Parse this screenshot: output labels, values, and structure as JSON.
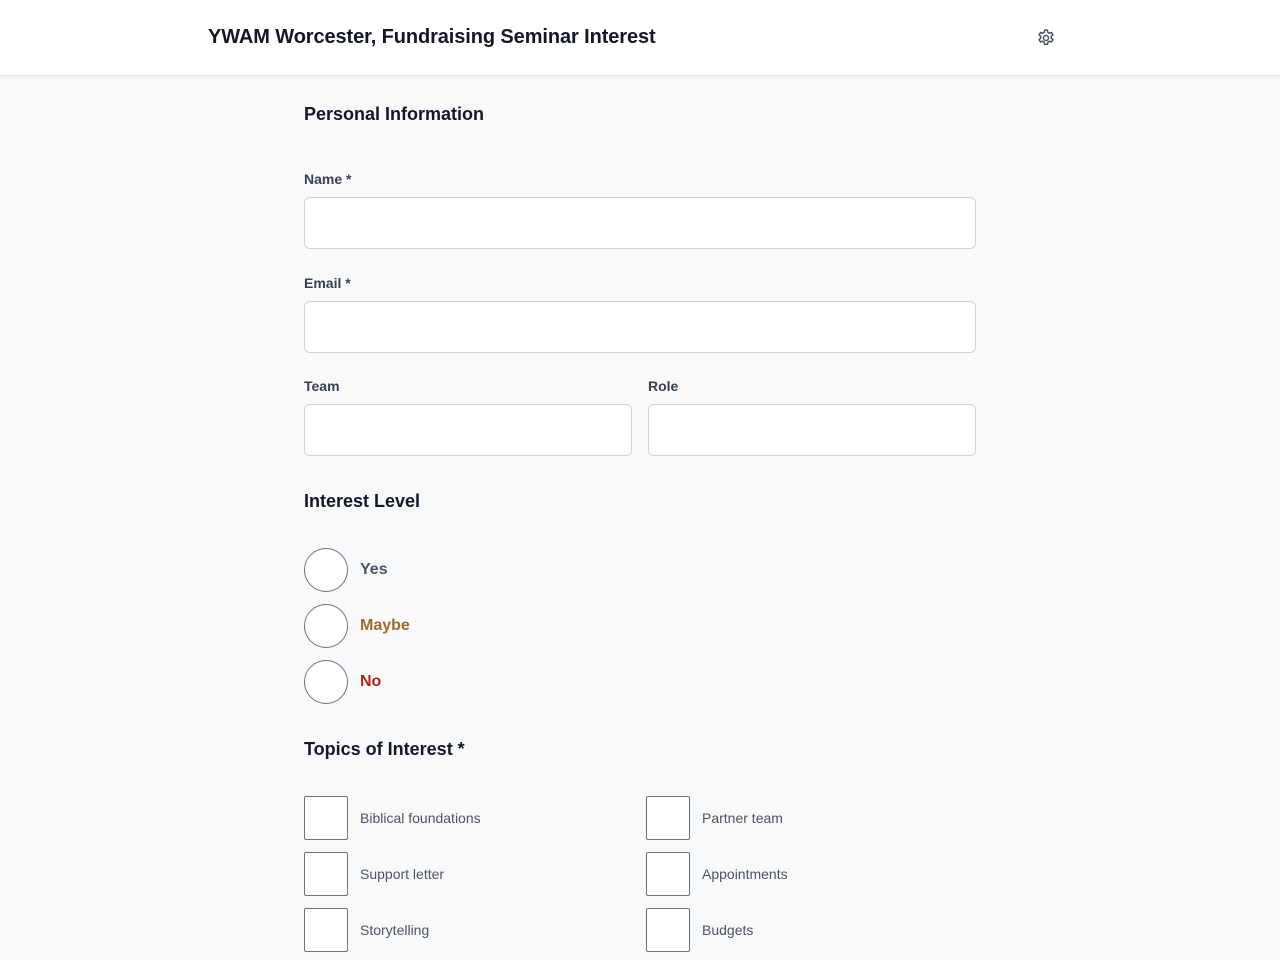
{
  "header": {
    "title": "YWAM Worcester, Fundraising Seminar Interest",
    "settings_icon": "gear-icon"
  },
  "personal": {
    "section_title": "Personal Information",
    "name_label": "Name *",
    "name_value": "",
    "email_label": "Email *",
    "email_value": "",
    "team_label": "Team",
    "team_value": "",
    "role_label": "Role",
    "role_value": ""
  },
  "interest": {
    "section_title": "Interest Level",
    "options": [
      {
        "label": "Yes",
        "color": "#4b5563"
      },
      {
        "label": "Maybe",
        "color": "#a16b2a"
      },
      {
        "label": "No",
        "color": "#b42318"
      }
    ]
  },
  "topics": {
    "section_title": "Topics of Interest *",
    "items": [
      {
        "label": "Biblical foundations"
      },
      {
        "label": "Partner team"
      },
      {
        "label": "Support letter"
      },
      {
        "label": "Appointments"
      },
      {
        "label": "Storytelling"
      },
      {
        "label": "Budgets"
      }
    ]
  }
}
